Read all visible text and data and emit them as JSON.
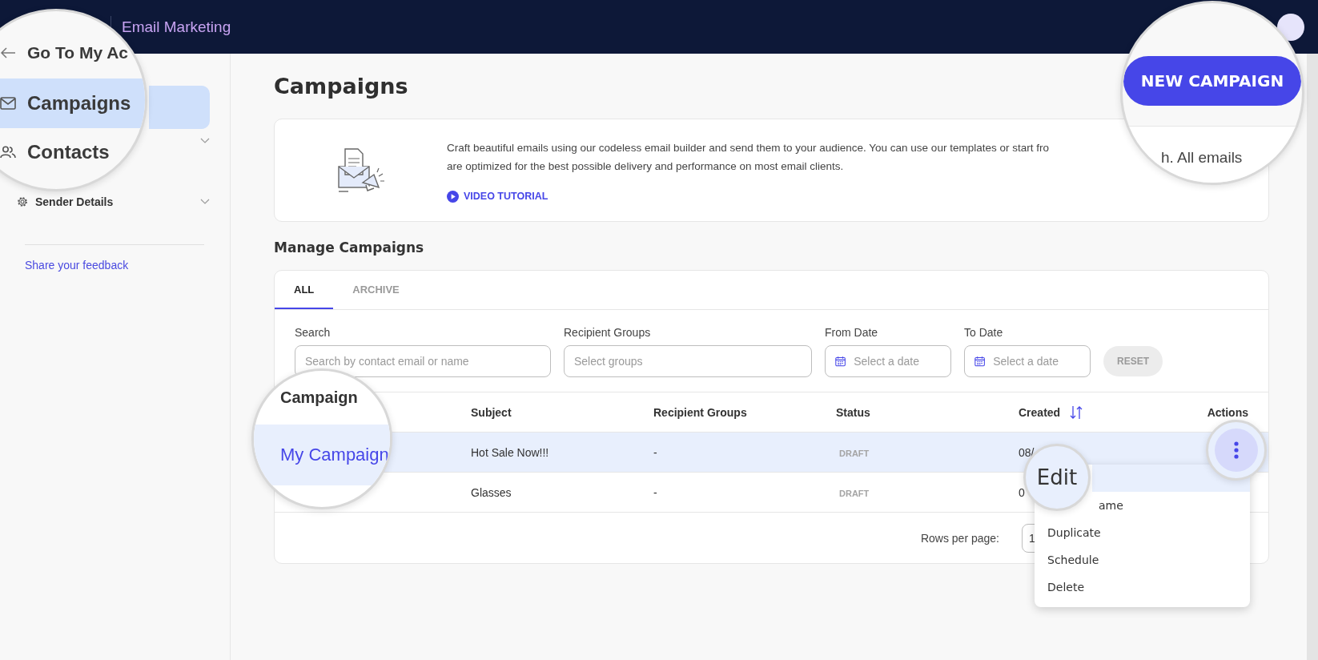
{
  "top_bar": {
    "app_title": "Email Marketing"
  },
  "sidebar": {
    "back_link": "Go To My Ac",
    "items": [
      {
        "label": "Campaigns",
        "selected": true,
        "expandable": false
      },
      {
        "label": "Contacts",
        "selected": false,
        "expandable": true
      },
      {
        "label": "Sender Details",
        "selected": false,
        "expandable": true
      }
    ],
    "feedback_link": "Share your feedback"
  },
  "page": {
    "title": "Campaigns",
    "new_campaign_button": "NEW CAMPAIGN",
    "intro": {
      "lines": [
        "Craft beautiful emails using our codeless email builder and send them to your audience. You can use our templates or start fro",
        "are optimized for the best possible delivery and performance on most email clients."
      ],
      "magnified_text": "h. All emails",
      "video_link": "VIDEO TUTORIAL"
    }
  },
  "manage": {
    "title": "Manage Campaigns",
    "tabs": [
      {
        "label": "ALL",
        "selected": true
      },
      {
        "label": "ARCHIVE",
        "selected": false
      }
    ],
    "filters": [
      {
        "kind": "text",
        "label": "Search",
        "placeholder": "Search by contact email or name"
      },
      {
        "kind": "select",
        "label": "Recipient Groups",
        "placeholder": "Select groups"
      },
      {
        "kind": "date",
        "label": "From Date",
        "placeholder": "Select a date"
      },
      {
        "kind": "date",
        "label": "To Date",
        "placeholder": "Select a date"
      }
    ],
    "reset_button": "RESET",
    "table": {
      "columns": [
        {
          "label": "Campaign",
          "sortable": false
        },
        {
          "label": "Subject",
          "sortable": false
        },
        {
          "label": "Recipient Groups",
          "sortable": false
        },
        {
          "label": "Status",
          "sortable": false
        },
        {
          "label": "Created",
          "sortable": true
        },
        {
          "label": "Actions",
          "sortable": false
        }
      ],
      "rows": [
        {
          "campaign": "My Campaign",
          "subject": "Hot Sale Now!!!",
          "recipient_groups": "-",
          "status": "DRAFT",
          "created": "08/",
          "selected": true
        },
        {
          "subject": "Glasses",
          "recipient_groups": "-",
          "status": "DRAFT",
          "created": "0",
          "selected": false
        }
      ]
    },
    "pagination": {
      "rows_per_page_label": "Rows per page:",
      "rows_per_page": "1"
    },
    "action_menu": {
      "items": [
        {
          "label": "Edit",
          "selected": true
        },
        {
          "label": "ame",
          "selected": false
        },
        {
          "label": "Duplicate",
          "selected": false
        },
        {
          "label": "Schedule",
          "selected": false
        },
        {
          "label": "Delete",
          "selected": false
        }
      ]
    }
  }
}
